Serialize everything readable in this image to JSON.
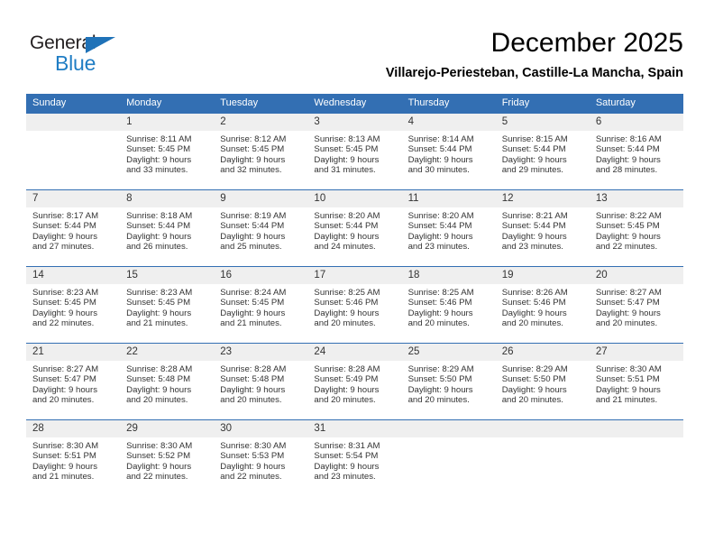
{
  "brand": {
    "name_top": "General",
    "name_bottom": "Blue",
    "triangle_icon": "triangle-icon",
    "color_blue": "#1f7dc4",
    "color_dark": "#231f20"
  },
  "header": {
    "month_title": "December 2025",
    "location": "Villarejo-Periesteban, Castille-La Mancha, Spain"
  },
  "calendar": {
    "accent_color": "#336fb3",
    "daynum_bg": "#efefef",
    "weekday_headers": [
      "Sunday",
      "Monday",
      "Tuesday",
      "Wednesday",
      "Thursday",
      "Friday",
      "Saturday"
    ],
    "weeks": [
      [
        {
          "day": "",
          "lines": []
        },
        {
          "day": "1",
          "lines": [
            "Sunrise: 8:11 AM",
            "Sunset: 5:45 PM",
            "Daylight: 9 hours",
            "and 33 minutes."
          ]
        },
        {
          "day": "2",
          "lines": [
            "Sunrise: 8:12 AM",
            "Sunset: 5:45 PM",
            "Daylight: 9 hours",
            "and 32 minutes."
          ]
        },
        {
          "day": "3",
          "lines": [
            "Sunrise: 8:13 AM",
            "Sunset: 5:45 PM",
            "Daylight: 9 hours",
            "and 31 minutes."
          ]
        },
        {
          "day": "4",
          "lines": [
            "Sunrise: 8:14 AM",
            "Sunset: 5:44 PM",
            "Daylight: 9 hours",
            "and 30 minutes."
          ]
        },
        {
          "day": "5",
          "lines": [
            "Sunrise: 8:15 AM",
            "Sunset: 5:44 PM",
            "Daylight: 9 hours",
            "and 29 minutes."
          ]
        },
        {
          "day": "6",
          "lines": [
            "Sunrise: 8:16 AM",
            "Sunset: 5:44 PM",
            "Daylight: 9 hours",
            "and 28 minutes."
          ]
        }
      ],
      [
        {
          "day": "7",
          "lines": [
            "Sunrise: 8:17 AM",
            "Sunset: 5:44 PM",
            "Daylight: 9 hours",
            "and 27 minutes."
          ]
        },
        {
          "day": "8",
          "lines": [
            "Sunrise: 8:18 AM",
            "Sunset: 5:44 PM",
            "Daylight: 9 hours",
            "and 26 minutes."
          ]
        },
        {
          "day": "9",
          "lines": [
            "Sunrise: 8:19 AM",
            "Sunset: 5:44 PM",
            "Daylight: 9 hours",
            "and 25 minutes."
          ]
        },
        {
          "day": "10",
          "lines": [
            "Sunrise: 8:20 AM",
            "Sunset: 5:44 PM",
            "Daylight: 9 hours",
            "and 24 minutes."
          ]
        },
        {
          "day": "11",
          "lines": [
            "Sunrise: 8:20 AM",
            "Sunset: 5:44 PM",
            "Daylight: 9 hours",
            "and 23 minutes."
          ]
        },
        {
          "day": "12",
          "lines": [
            "Sunrise: 8:21 AM",
            "Sunset: 5:44 PM",
            "Daylight: 9 hours",
            "and 23 minutes."
          ]
        },
        {
          "day": "13",
          "lines": [
            "Sunrise: 8:22 AM",
            "Sunset: 5:45 PM",
            "Daylight: 9 hours",
            "and 22 minutes."
          ]
        }
      ],
      [
        {
          "day": "14",
          "lines": [
            "Sunrise: 8:23 AM",
            "Sunset: 5:45 PM",
            "Daylight: 9 hours",
            "and 22 minutes."
          ]
        },
        {
          "day": "15",
          "lines": [
            "Sunrise: 8:23 AM",
            "Sunset: 5:45 PM",
            "Daylight: 9 hours",
            "and 21 minutes."
          ]
        },
        {
          "day": "16",
          "lines": [
            "Sunrise: 8:24 AM",
            "Sunset: 5:45 PM",
            "Daylight: 9 hours",
            "and 21 minutes."
          ]
        },
        {
          "day": "17",
          "lines": [
            "Sunrise: 8:25 AM",
            "Sunset: 5:46 PM",
            "Daylight: 9 hours",
            "and 20 minutes."
          ]
        },
        {
          "day": "18",
          "lines": [
            "Sunrise: 8:25 AM",
            "Sunset: 5:46 PM",
            "Daylight: 9 hours",
            "and 20 minutes."
          ]
        },
        {
          "day": "19",
          "lines": [
            "Sunrise: 8:26 AM",
            "Sunset: 5:46 PM",
            "Daylight: 9 hours",
            "and 20 minutes."
          ]
        },
        {
          "day": "20",
          "lines": [
            "Sunrise: 8:27 AM",
            "Sunset: 5:47 PM",
            "Daylight: 9 hours",
            "and 20 minutes."
          ]
        }
      ],
      [
        {
          "day": "21",
          "lines": [
            "Sunrise: 8:27 AM",
            "Sunset: 5:47 PM",
            "Daylight: 9 hours",
            "and 20 minutes."
          ]
        },
        {
          "day": "22",
          "lines": [
            "Sunrise: 8:28 AM",
            "Sunset: 5:48 PM",
            "Daylight: 9 hours",
            "and 20 minutes."
          ]
        },
        {
          "day": "23",
          "lines": [
            "Sunrise: 8:28 AM",
            "Sunset: 5:48 PM",
            "Daylight: 9 hours",
            "and 20 minutes."
          ]
        },
        {
          "day": "24",
          "lines": [
            "Sunrise: 8:28 AM",
            "Sunset: 5:49 PM",
            "Daylight: 9 hours",
            "and 20 minutes."
          ]
        },
        {
          "day": "25",
          "lines": [
            "Sunrise: 8:29 AM",
            "Sunset: 5:50 PM",
            "Daylight: 9 hours",
            "and 20 minutes."
          ]
        },
        {
          "day": "26",
          "lines": [
            "Sunrise: 8:29 AM",
            "Sunset: 5:50 PM",
            "Daylight: 9 hours",
            "and 20 minutes."
          ]
        },
        {
          "day": "27",
          "lines": [
            "Sunrise: 8:30 AM",
            "Sunset: 5:51 PM",
            "Daylight: 9 hours",
            "and 21 minutes."
          ]
        }
      ],
      [
        {
          "day": "28",
          "lines": [
            "Sunrise: 8:30 AM",
            "Sunset: 5:51 PM",
            "Daylight: 9 hours",
            "and 21 minutes."
          ]
        },
        {
          "day": "29",
          "lines": [
            "Sunrise: 8:30 AM",
            "Sunset: 5:52 PM",
            "Daylight: 9 hours",
            "and 22 minutes."
          ]
        },
        {
          "day": "30",
          "lines": [
            "Sunrise: 8:30 AM",
            "Sunset: 5:53 PM",
            "Daylight: 9 hours",
            "and 22 minutes."
          ]
        },
        {
          "day": "31",
          "lines": [
            "Sunrise: 8:31 AM",
            "Sunset: 5:54 PM",
            "Daylight: 9 hours",
            "and 23 minutes."
          ]
        },
        {
          "day": "",
          "lines": []
        },
        {
          "day": "",
          "lines": []
        },
        {
          "day": "",
          "lines": []
        }
      ]
    ]
  }
}
